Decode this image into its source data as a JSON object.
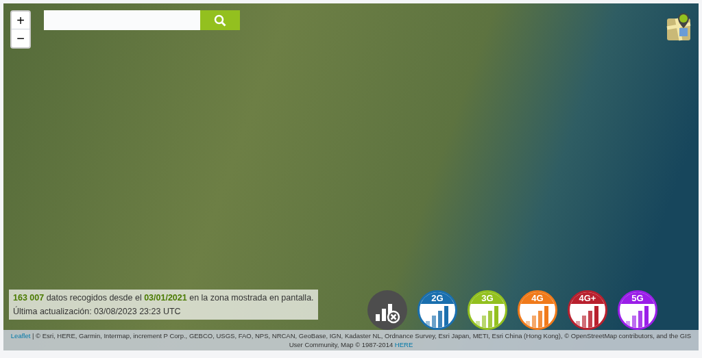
{
  "zoom": {
    "in": "+",
    "out": "−"
  },
  "info": {
    "count": "163 007",
    "text_before": "datos recogidos desde el",
    "date": "03/01/2021",
    "text_after": "en la zona mostrada en pantalla.",
    "updated": "Última actualización: 03/08/2023 23:23 UTC"
  },
  "networks": [
    {
      "kind": "none",
      "color": "#4d4d4d"
    },
    {
      "kind": "network",
      "label": "2G",
      "color": "#1a6fae"
    },
    {
      "kind": "network",
      "label": "3G",
      "color": "#93c01f"
    },
    {
      "kind": "network",
      "label": "4G",
      "color": "#f07a1a"
    },
    {
      "kind": "network",
      "label": "4G+",
      "color": "#b8202e"
    },
    {
      "kind": "network",
      "label": "5G",
      "color": "#9a1ee8"
    }
  ],
  "attribution": {
    "leaflet": "Leaflet",
    "text": "| © Esri, HERE, Garmin, Intermap, increment P Corp., GEBCO, USGS, FAO, NPS, NRCAN, GeoBase, IGN, Kadaster NL, Ordnance Survey, Esri Japan, METI, Esri China (Hong Kong), © OpenStreetMap contributors, and the GIS User Community, Map © 1987-2014",
    "here": "HERE"
  }
}
